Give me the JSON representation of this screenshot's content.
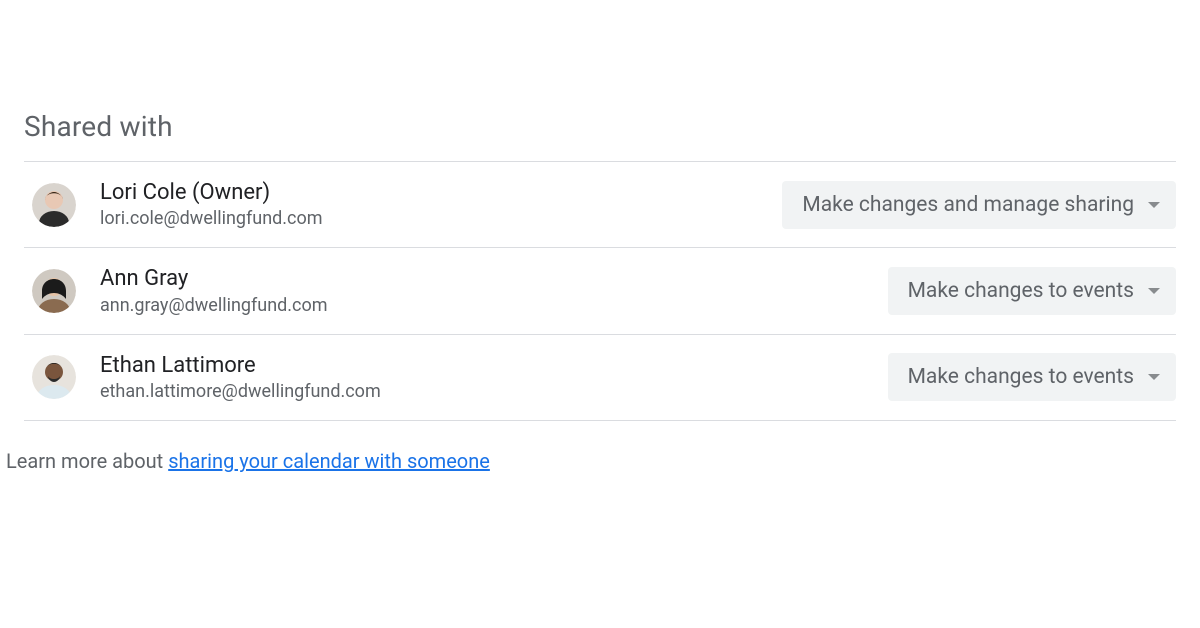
{
  "section_title": "Shared with",
  "people": [
    {
      "name": "Lori Cole (Owner)",
      "email": "lori.cole@dwellingfund.com",
      "permission": "Make changes and manage sharing",
      "avatar": "lori"
    },
    {
      "name": "Ann Gray",
      "email": "ann.gray@dwellingfund.com",
      "permission": "Make changes to events",
      "avatar": "ann"
    },
    {
      "name": "Ethan Lattimore",
      "email": "ethan.lattimore@dwellingfund.com",
      "permission": "Make changes to events",
      "avatar": "ethan"
    }
  ],
  "footer": {
    "prefix": "Learn more about ",
    "link_text": "sharing your calendar with someone"
  }
}
